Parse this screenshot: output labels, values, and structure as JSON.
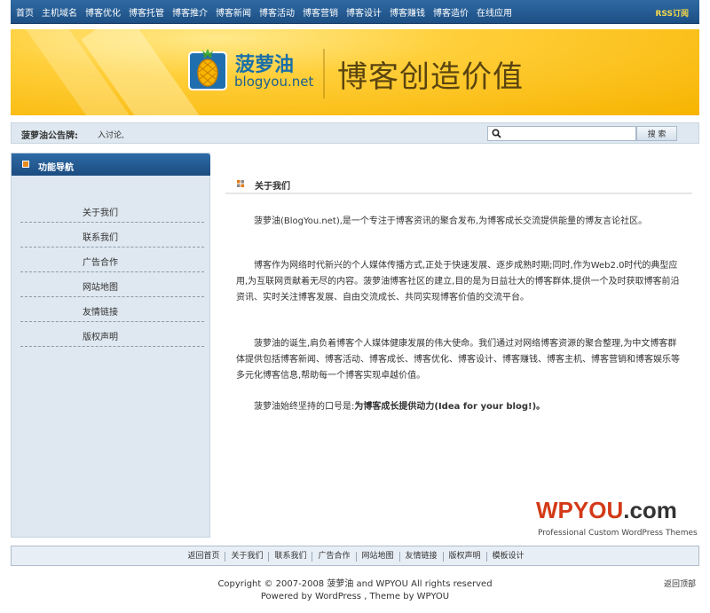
{
  "top_nav": {
    "links": [
      "首页",
      "主机域名",
      "博客优化",
      "博客托管",
      "博客推介",
      "博客新闻",
      "博客活动",
      "博客营销",
      "博客设计",
      "博客赚钱",
      "博客造价",
      "在线应用"
    ],
    "rss": "RSS订阅"
  },
  "banner": {
    "logo_title": "菠萝油",
    "logo_subtitle": "blogyou.net",
    "slogan": "博客创造价值"
  },
  "notice": {
    "label": "菠萝油公告牌:",
    "text": "入讨论,",
    "search_placeholder": "",
    "search_button": "搜 索"
  },
  "sidebar": {
    "title": "功能导航",
    "items": [
      "关于我们",
      "联系我们",
      "广告合作",
      "网站地图",
      "友情链接",
      "版权声明"
    ]
  },
  "content": {
    "title": "关于我们",
    "paragraphs": [
      "菠萝油(BlogYou.net),是一个专注于博客资讯的聚合发布,为博客成长交流提供能量的博友言论社区。",
      "博客作为网络时代新兴的个人媒体传播方式,正处于快速发展、逐步成熟时期;同时,作为Web2.0时代的典型应用,为互联网贡献着无尽的内容。菠萝油博客社区的建立,目的是为日益壮大的博客群体,提供一个及时获取博客前沿资讯、实时关注博客发展、自由交流成长、共同实现博客价值的交流平台。",
      "菠萝油的诞生,肩负着博客个人媒体健康发展的伟大使命。我们通过对网络博客资源的聚合整理,为中文博客群体提供包括博客新闻、博客活动、博客成长、博客优化、博客设计、博客赚钱、博客主机、博客营销和博客娱乐等多元化博客信息,帮助每一个博客实现卓越价值。",
      "菠萝油始终坚持的口号是:",
      "为博客成长提供动力(Idea for your blog!)。"
    ]
  },
  "watermark": {
    "brand_main": "WPYOU",
    "brand_suffix": ".com",
    "tagline": "Professional Custom WordPress Themes"
  },
  "footer": {
    "links": [
      "返回首页",
      "关于我们",
      "联系我们",
      "广告合作",
      "网站地图",
      "友情链接",
      "版权声明",
      "模板设计"
    ],
    "copyright": "Copyright © 2007-2008 菠萝油 and WPYOU All rights reserved",
    "powered": "Powered by WordPress , Theme by WPYOU",
    "back_to_top": "返回顶部"
  },
  "colors": {
    "nav_bg": "#1d4f84",
    "banner_bg": "#ffc21a",
    "panel_bg": "#dfe8f0",
    "brand_red": "#d33a18"
  }
}
